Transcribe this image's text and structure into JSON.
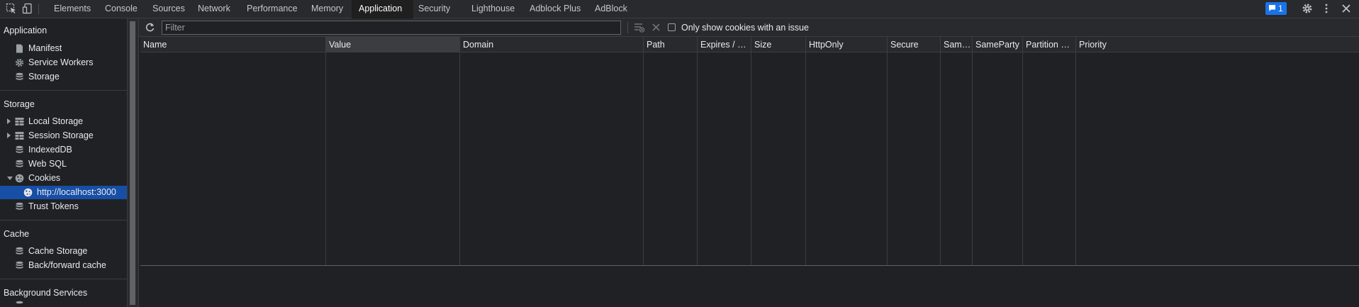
{
  "devtools": {
    "tabs": [
      {
        "label": "Elements",
        "active": false
      },
      {
        "label": "Console",
        "active": false
      },
      {
        "label": "Sources",
        "active": false
      },
      {
        "label": "Network",
        "active": false
      },
      {
        "label": "Performance",
        "active": false
      },
      {
        "label": "Memory",
        "active": false
      },
      {
        "label": "Application",
        "active": true
      },
      {
        "label": "Security",
        "active": false
      },
      {
        "label": "Lighthouse",
        "active": false
      },
      {
        "label": "Adblock Plus",
        "active": false
      },
      {
        "label": "AdBlock",
        "active": false
      }
    ],
    "issues_count": "1",
    "accent_color": "#1a73e8"
  },
  "sidebar": {
    "sections": [
      {
        "heading": "Application",
        "items": [
          {
            "label": "Manifest",
            "icon": "document-icon"
          },
          {
            "label": "Service Workers",
            "icon": "gear-icon"
          },
          {
            "label": "Storage",
            "icon": "database-icon"
          }
        ]
      },
      {
        "heading": "Storage",
        "items": [
          {
            "label": "Local Storage",
            "icon": "table-icon",
            "expander": "collapsed"
          },
          {
            "label": "Session Storage",
            "icon": "table-icon",
            "expander": "collapsed"
          },
          {
            "label": "IndexedDB",
            "icon": "database-icon"
          },
          {
            "label": "Web SQL",
            "icon": "database-icon"
          },
          {
            "label": "Cookies",
            "icon": "cookie-icon",
            "expander": "expanded"
          },
          {
            "label": "http://localhost:3000",
            "icon": "cookie-icon",
            "selected": true,
            "child": true
          },
          {
            "label": "Trust Tokens",
            "icon": "database-icon"
          }
        ]
      },
      {
        "heading": "Cache",
        "items": [
          {
            "label": "Cache Storage",
            "icon": "database-icon"
          },
          {
            "label": "Back/forward cache",
            "icon": "database-icon"
          }
        ]
      },
      {
        "heading": "Background Services",
        "items": []
      }
    ]
  },
  "toolbar": {
    "filter_placeholder": "Filter",
    "filter_value": "",
    "only_issues_label": "Only show cookies with an issue",
    "only_issues_checked": false
  },
  "table": {
    "columns": [
      "Name",
      "Value",
      "Domain",
      "Path",
      "Expires / Max...",
      "Size",
      "HttpOnly",
      "Secure",
      "SameS...",
      "SameParty",
      "Partition Key",
      "Priority"
    ],
    "sorted_column": "Value",
    "rows": []
  }
}
